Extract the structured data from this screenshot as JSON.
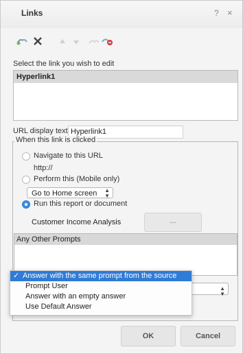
{
  "dialog": {
    "title": "Links",
    "help_icon": "?",
    "close_icon": "×"
  },
  "toolbar": {
    "icons": [
      "add-link-icon",
      "delete-icon",
      "move-up-icon",
      "move-down-icon",
      "link-icon",
      "remove-link-icon"
    ]
  },
  "link_list": {
    "label": "Select the link you wish to edit",
    "items": [
      "Hyperlink1"
    ]
  },
  "url_display": {
    "label": "URL display text",
    "value": "Hyperlink1"
  },
  "click_group": {
    "legend": "When this link is clicked",
    "navigate_label": "Navigate to this URL",
    "url_value": "http://",
    "perform_label": "Perform this (Mobile only)",
    "perform_select_value": "Go to Home screen",
    "run_label": "Run this report or document",
    "report_name": "Customer Income Analysis",
    "browse_label": "..."
  },
  "prompts": {
    "header": "Any Other Prompts"
  },
  "answer_dropdown": {
    "options": [
      "Answer with the same prompt from the source",
      "Prompt User",
      "Answer with an empty answer",
      "Use Default Answer"
    ],
    "selected_index": 0
  },
  "buttons": {
    "ok": "OK",
    "cancel": "Cancel"
  }
}
